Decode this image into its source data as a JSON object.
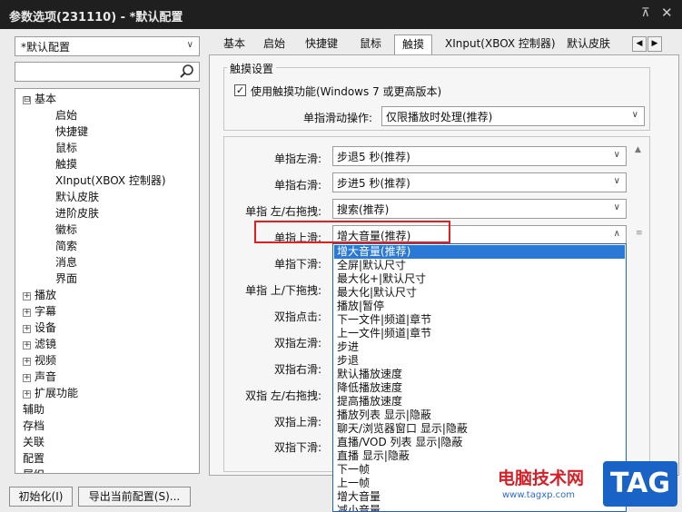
{
  "window": {
    "title": "参数选项(231110) - *默认配置",
    "pin_glyph": "⊼",
    "close_glyph": "✕"
  },
  "profile_select": {
    "value": "*默认配置"
  },
  "tree": [
    {
      "label": "基本",
      "expander": "⊟"
    },
    {
      "label": "启始"
    },
    {
      "label": "快捷键"
    },
    {
      "label": "鼠标"
    },
    {
      "label": "触摸"
    },
    {
      "label": "XInput(XBOX 控制器)"
    },
    {
      "label": "默认皮肤"
    },
    {
      "label": "进阶皮肤"
    },
    {
      "label": "徽标"
    },
    {
      "label": "简索"
    },
    {
      "label": "消息"
    },
    {
      "label": "界面"
    },
    {
      "label": "播放",
      "expander": "+"
    },
    {
      "label": "字幕",
      "expander": "+"
    },
    {
      "label": "设备",
      "expander": "+"
    },
    {
      "label": "滤镜",
      "expander": "+"
    },
    {
      "label": "视频",
      "expander": "+"
    },
    {
      "label": "声音",
      "expander": "+"
    },
    {
      "label": "扩展功能",
      "expander": "+"
    },
    {
      "label": "辅助"
    },
    {
      "label": "存档"
    },
    {
      "label": "关联"
    },
    {
      "label": "配置"
    },
    {
      "label": "属织"
    }
  ],
  "tabs": [
    "基本",
    "启始",
    "快捷键",
    "鼠标",
    "触摸",
    "XInput(XBOX 控制器)",
    "默认皮肤"
  ],
  "active_tab": "触摸",
  "tab_scroll": {
    "left": "◀",
    "right": "▶"
  },
  "touch": {
    "group_title": "触摸设置",
    "enable_checkbox": {
      "checked": true,
      "glyph": "✓",
      "label": "使用触摸功能(Windows 7 或更高版本)"
    },
    "single_slide": {
      "label": "单指滑动操作:",
      "value": "仅限播放时处理(推荐)"
    },
    "rows": [
      {
        "label": "单指左滑:",
        "value": "步退5 秒(推荐)"
      },
      {
        "label": "单指右滑:",
        "value": "步进5 秒(推荐)"
      },
      {
        "label": "单指 左/右拖拽:",
        "value": "搜索(推荐)"
      },
      {
        "label": "单指上滑:",
        "value": "增大音量(推荐)"
      },
      {
        "label": "单指下滑:",
        "value": ""
      },
      {
        "label": "单指 上/下拖拽:",
        "value": ""
      },
      {
        "label": "双指点击:",
        "value": ""
      },
      {
        "label": "双指左滑:",
        "value": ""
      },
      {
        "label": "双指右滑:",
        "value": ""
      },
      {
        "label": "双指 左/右拖拽:",
        "value": ""
      },
      {
        "label": "双指上滑:",
        "value": ""
      },
      {
        "label": "双指下滑:",
        "value": ""
      }
    ],
    "dropdown_open_arrow": "∧",
    "combo_arrow": "∨"
  },
  "dropdown": {
    "selected": "增大音量(推荐)",
    "options": [
      "增大音量(推荐)",
      "全屏|默认尺寸",
      "最大化+|默认尺寸",
      "最大化|默认尺寸",
      "播放|暂停",
      "下一文件|频道|章节",
      "上一文件|频道|章节",
      "步进",
      "步退",
      "默认播放速度",
      "降低播放速度",
      "提高播放速度",
      "播放列表 显示|隐蔽",
      "聊天/浏览器窗口 显示|隐蔽",
      "直播/VOD 列表 显示|隐蔽",
      "直播 显示|隐蔽",
      "下一帧",
      "上一帧",
      "增大音量",
      "减小音量"
    ]
  },
  "buttons": {
    "init": "初始化(I)",
    "export": "导出当前配置(S)..."
  },
  "watermark": {
    "text": "电脑技术网",
    "url": "www.tagxp.com",
    "tag": "TAG"
  },
  "colors": {
    "accent": "#2b79d6",
    "highlight_box": "#e02020",
    "titlebar": "#1f1f1f"
  }
}
